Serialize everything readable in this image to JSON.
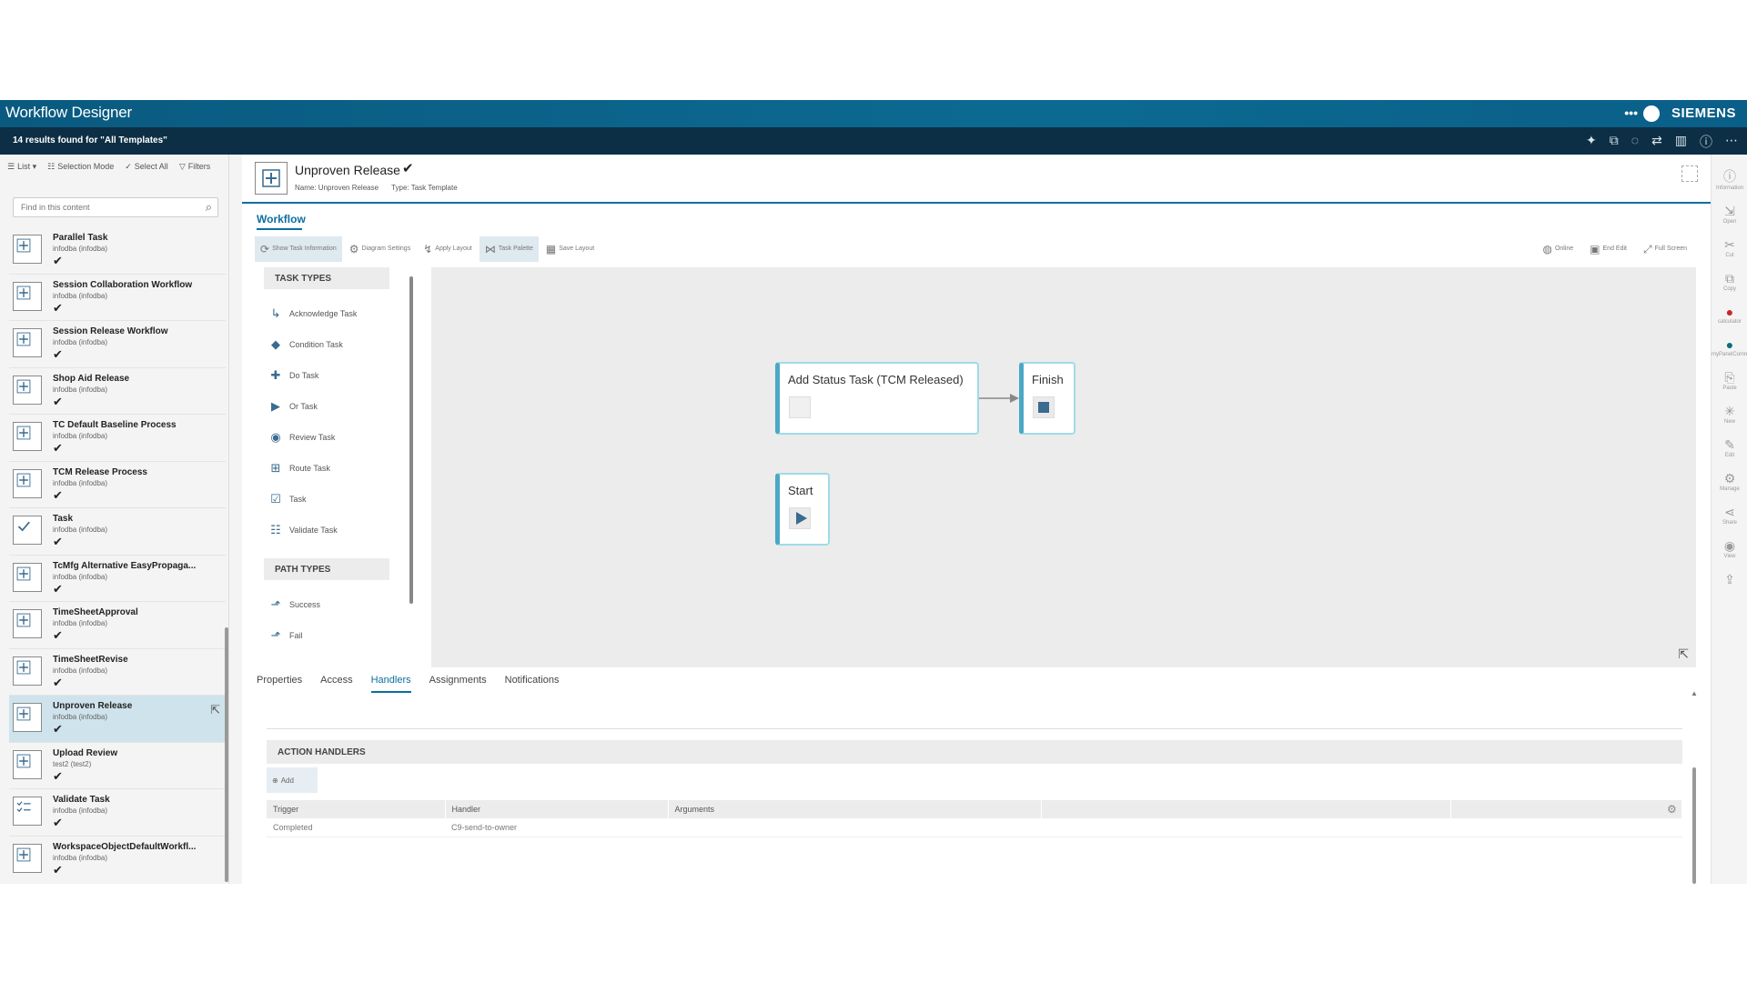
{
  "app": {
    "title": "Workflow Designer",
    "brand": "SIEMENS",
    "more": "•••"
  },
  "header2": {
    "summary": "14 results found for \"All Templates\""
  },
  "left": {
    "toolbar": [
      {
        "icon": "list-icon",
        "label": "List ▾"
      },
      {
        "icon": "selection-mode-icon",
        "label": "Selection Mode"
      },
      {
        "icon": "select-all-icon",
        "label": "Select All"
      },
      {
        "icon": "filter-icon",
        "label": "Filters"
      }
    ],
    "search_placeholder": "Find in this content",
    "items": [
      {
        "name": "Parallel Task",
        "owner": "infodba (infodba)",
        "selected": false
      },
      {
        "name": "Session Collaboration Workflow",
        "owner": "infodba (infodba)",
        "selected": false
      },
      {
        "name": "Session Release Workflow",
        "owner": "infodba (infodba)",
        "selected": false
      },
      {
        "name": "Shop Aid Release",
        "owner": "infodba (infodba)",
        "selected": false
      },
      {
        "name": "TC Default Baseline Process",
        "owner": "infodba (infodba)",
        "selected": false
      },
      {
        "name": "TCM Release Process",
        "owner": "infodba (infodba)",
        "selected": false
      },
      {
        "name": "Task",
        "owner": "infodba (infodba)",
        "selected": false
      },
      {
        "name": "TcMfg Alternative EasyPropaga...",
        "owner": "infodba (infodba)",
        "selected": false
      },
      {
        "name": "TimeSheetApproval",
        "owner": "infodba (infodba)",
        "selected": false
      },
      {
        "name": "TimeSheetRevise",
        "owner": "infodba (infodba)",
        "selected": false
      },
      {
        "name": "Unproven Release",
        "owner": "infodba (infodba)",
        "selected": true
      },
      {
        "name": "Upload Review",
        "owner": "test2 (test2)",
        "selected": false
      },
      {
        "name": "Validate Task",
        "owner": "infodba (infodba)",
        "selected": false
      },
      {
        "name": "WorkspaceObjectDefaultWorkfl...",
        "owner": "infodba (infodba)",
        "selected": false
      }
    ]
  },
  "object": {
    "name": "Unproven Release",
    "name_prop": "Name: Unproven Release",
    "type_prop": "Type: Task Template"
  },
  "main": {
    "tab": "Workflow",
    "toolbar": [
      {
        "icon": "show-task-info-icon",
        "label": "Show Task Information",
        "active": true
      },
      {
        "icon": "diagram-settings-icon",
        "label": "Diagram Settings",
        "active": false
      },
      {
        "icon": "apply-layout-icon",
        "label": "Apply Layout",
        "active": false
      },
      {
        "icon": "task-palette-icon",
        "label": "Task Palette",
        "active": true
      },
      {
        "icon": "save-layout-icon",
        "label": "Save Layout",
        "active": false
      }
    ],
    "toolbar_right": [
      {
        "icon": "online-icon",
        "label": "Online"
      },
      {
        "icon": "end-edit-icon",
        "label": "End Edit"
      },
      {
        "icon": "full-screen-icon",
        "label": "Full Screen"
      }
    ],
    "palette": {
      "task_types_label": "TASK TYPES",
      "task_types": [
        {
          "icon": "acknowledge-task-icon",
          "label": "Acknowledge Task"
        },
        {
          "icon": "condition-task-icon",
          "label": "Condition Task"
        },
        {
          "icon": "do-task-icon",
          "label": "Do Task"
        },
        {
          "icon": "or-task-icon",
          "label": "Or Task"
        },
        {
          "icon": "review-task-icon",
          "label": "Review Task"
        },
        {
          "icon": "route-task-icon",
          "label": "Route Task"
        },
        {
          "icon": "task-icon",
          "label": "Task"
        },
        {
          "icon": "validate-task-icon",
          "label": "Validate Task"
        }
      ],
      "path_types_label": "PATH TYPES",
      "path_types": [
        {
          "icon": "success-path-icon",
          "label": "Success"
        },
        {
          "icon": "fail-path-icon",
          "label": "Fail"
        }
      ]
    },
    "diagram": {
      "node_status": "Add Status Task (TCM Released)",
      "node_finish": "Finish",
      "node_start": "Start"
    },
    "bottom_tabs": [
      {
        "label": "Properties",
        "active": false
      },
      {
        "label": "Access",
        "active": false
      },
      {
        "label": "Handlers",
        "active": true
      },
      {
        "label": "Assignments",
        "active": false
      },
      {
        "label": "Notifications",
        "active": false
      }
    ],
    "action_handlers_label": "ACTION HANDLERS",
    "add_label": "Add",
    "table": {
      "columns": [
        "Trigger",
        "Handler",
        "Arguments",
        "",
        ""
      ],
      "rows": [
        [
          "Completed",
          "C9-send-to-owner",
          "",
          "",
          ""
        ]
      ]
    }
  },
  "rail": [
    {
      "icon": "information-icon",
      "label": "Information"
    },
    {
      "icon": "open-icon",
      "label": "Open"
    },
    {
      "icon": "cut-icon",
      "label": "Cut"
    },
    {
      "icon": "copy-icon",
      "label": "Copy"
    },
    {
      "icon": "calculator-icon",
      "label": "calculator"
    },
    {
      "icon": "my-panel-command-icon",
      "label": "myPanelCommand"
    },
    {
      "icon": "paste-icon",
      "label": "Paste"
    },
    {
      "icon": "new-icon",
      "label": "New"
    },
    {
      "icon": "edit-icon",
      "label": "Edit"
    },
    {
      "icon": "manage-icon",
      "label": "Manage"
    },
    {
      "icon": "share-icon",
      "label": "Share"
    },
    {
      "icon": "view-icon",
      "label": "View"
    },
    {
      "icon": "export-icon",
      "label": ""
    }
  ],
  "colors": {
    "header": "#0c6a92",
    "subheader": "#0c2f45",
    "accent": "#0a6fa0",
    "node_border": "#9fdbe8",
    "selected_row": "#cfe3ec"
  }
}
